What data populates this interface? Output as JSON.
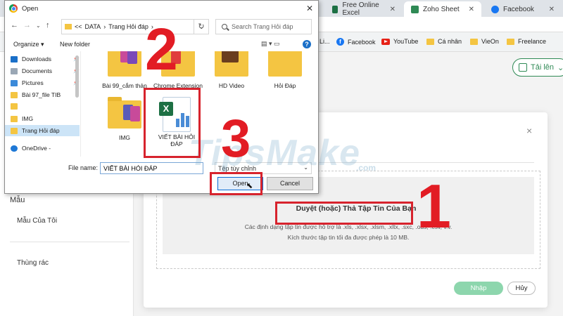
{
  "browser": {
    "tabs": [
      {
        "label": "Free Online Excel",
        "active": false
      },
      {
        "label": "Zoho Sheet",
        "active": true
      },
      {
        "label": "Facebook",
        "active": false
      }
    ],
    "bookmarks": [
      "Li...",
      "Facebook",
      "YouTube",
      "Cá nhân",
      "VieOn",
      "Freelance"
    ]
  },
  "app": {
    "upload_button": "Tải lên",
    "sidebar": {
      "heading": "Mẫu",
      "item_my_templates": "Mẫu Của Tôi",
      "item_trash": "Thùng rác"
    }
  },
  "modal": {
    "browse_label": "Duyệt (hoặc) Thả Tập Tin Của Bạn",
    "formats_text": "Các định dạng tập tin được hỗ trợ là .xls, .xlsx, .xlsm, .xltx, .sxc, .ods, .csv, v.v.",
    "max_size_text": "Kích thước tập tin tối đa được phép là 10 MB.",
    "draft_button": "Nhập",
    "cancel_button": "Hủy",
    "close_icon": "×"
  },
  "dialog": {
    "title": "Open",
    "path": [
      "<<",
      "DATA",
      "›",
      "Trang Hỏi đáp",
      "›"
    ],
    "search_placeholder": "Search Trang Hỏi đáp",
    "organize_label": "Organize ▾",
    "new_folder_label": "New folder",
    "nav_items": [
      {
        "label": "Downloads",
        "pinned": true
      },
      {
        "label": "Documents",
        "pinned": true
      },
      {
        "label": "Pictures",
        "pinned": true
      },
      {
        "label": "Bài 97_file TIB",
        "pinned": false
      },
      {
        "label": "",
        "pinned": false
      },
      {
        "label": "IMG",
        "pinned": false
      },
      {
        "label": "Trang Hỏi đáp",
        "pinned": false,
        "selected": true
      },
      {
        "label": "OneDrive -",
        "pinned": false
      }
    ],
    "files": [
      {
        "name": "Bài 99_cắm thản",
        "type": "folder"
      },
      {
        "name": "Chrome Extension",
        "type": "folder"
      },
      {
        "name": "HD Video",
        "type": "folder"
      },
      {
        "name": "Hỏi Đáp",
        "type": "folder"
      },
      {
        "name": "IMG",
        "type": "folder"
      },
      {
        "name": "VIẾT BÀI HỎI ĐÁP",
        "type": "excel",
        "selected": true
      }
    ],
    "file_name_label": "File name:",
    "file_name_value": "VIẾT BÀI HỎI ĐÁP",
    "file_type_value": "Tệp tùy chỉnh",
    "open_button": "Open",
    "cancel_button": "Cancel"
  },
  "annotations": {
    "step1": "1",
    "step2": "2",
    "step3": "3",
    "accent_color": "#e21c24"
  },
  "watermark": {
    "text": "TipsMake",
    "suffix": ".com"
  }
}
